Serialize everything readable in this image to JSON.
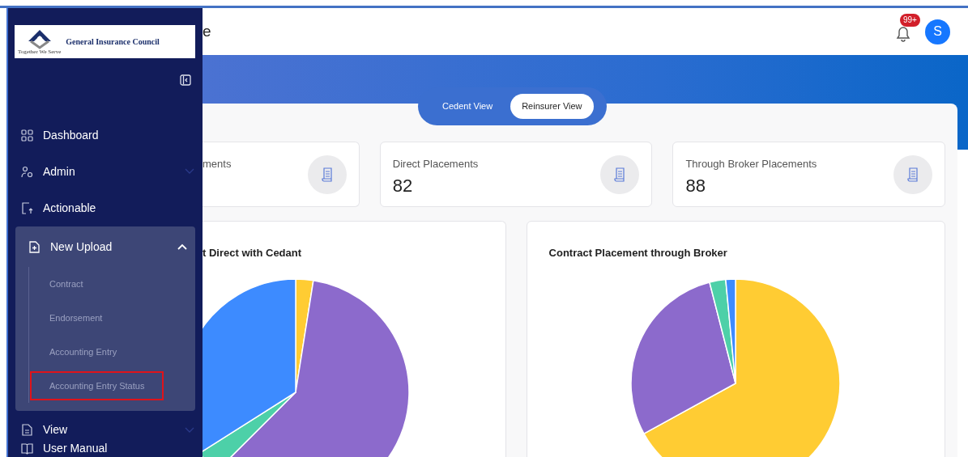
{
  "sidebar": {
    "logo_text": "General Insurance Council",
    "logo_tagline": "Together We Serve",
    "items": [
      {
        "label": "Dashboard",
        "kind": "plain"
      },
      {
        "label": "Admin",
        "kind": "collapsed"
      },
      {
        "label": "Actionable",
        "kind": "plain"
      },
      {
        "label": "New Upload",
        "kind": "expanded",
        "children": [
          {
            "label": "Contract",
            "highlighted": false
          },
          {
            "label": "Endorsement",
            "highlighted": false
          },
          {
            "label": "Accounting Entry",
            "highlighted": false
          },
          {
            "label": "Accounting Entry Status",
            "highlighted": true
          }
        ]
      },
      {
        "label": "View",
        "kind": "collapsed"
      },
      {
        "label": "User Manual",
        "kind": "plain"
      }
    ]
  },
  "header": {
    "title": "e",
    "notification_badge": "99+",
    "avatar": "S"
  },
  "view_toggle": [
    {
      "label": "Cedent View",
      "selected": false
    },
    {
      "label": "Reinsurer View",
      "selected": true
    }
  ],
  "stats": [
    {
      "label": "ments"
    },
    {
      "label": "Direct Placements",
      "value": "82"
    },
    {
      "label": "Through Broker Placements",
      "value": "88"
    }
  ],
  "charts": [
    {
      "title": "t Direct with Cedant"
    },
    {
      "title": "Contract Placement through Broker"
    }
  ]
}
